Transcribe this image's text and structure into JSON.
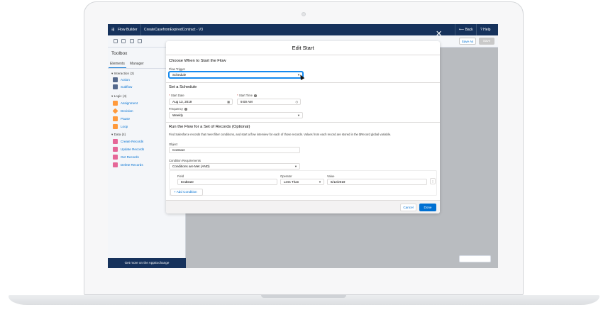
{
  "topbar": {
    "app_name": "Flow Builder",
    "flow_name": "CreateCasefromExpiredContract - V3",
    "back_label": "Back",
    "help_label": "Help"
  },
  "toolbar": {
    "save_as_label": "Save As",
    "save_label": "Save"
  },
  "toolbox": {
    "title": "Toolbox",
    "tabs": [
      "Elements",
      "Manager"
    ],
    "groups": [
      {
        "label": "Interaction (2)",
        "items": [
          "Action",
          "Subflow"
        ]
      },
      {
        "label": "Logic (4)",
        "items": [
          "Assignment",
          "Decision",
          "Pause",
          "Loop"
        ]
      },
      {
        "label": "Data (4)",
        "items": [
          "Create Records",
          "Update Records",
          "Get Records",
          "Delete Records"
        ]
      }
    ],
    "appexchange_label": "Get more on the AppExchange"
  },
  "modal": {
    "title": "Edit Start",
    "section1": {
      "title": "Choose When to Start the Flow",
      "trigger_label": "Flow Trigger",
      "trigger_value": "Schedule"
    },
    "section2": {
      "title": "Set a Schedule",
      "start_date_label": "Start Date",
      "start_date_value": "Aug 13, 2019",
      "start_time_label": "Start Time",
      "start_time_value": "9:00 AM",
      "frequency_label": "Frequency",
      "frequency_value": "Weekly"
    },
    "section3": {
      "title": "Run the Flow for a Set of Records (Optional)",
      "description": "Find Salesforce records that meet filter conditions, and start a flow interview for each of those records. Values from each record are stored in the $Record global variable.",
      "object_label": "Object",
      "object_value": "Contract",
      "condition_req_label": "Condition Requirements",
      "condition_req_value": "Conditions are Met (AND)",
      "field_label": "Field",
      "field_value": "EndDate",
      "operator_label": "Operator",
      "operator_value": "Less Than",
      "value_label": "Value",
      "value_value": "8/12/2019",
      "add_condition_label": "Add Condition"
    },
    "cancel_label": "Cancel",
    "done_label": "Done"
  },
  "colors": {
    "brand_navy": "#16325c",
    "accent_blue": "#0070d2",
    "interaction_icon": "#54698d",
    "logic_icon": "#ff9a3c",
    "data_icon": "#e56798"
  }
}
